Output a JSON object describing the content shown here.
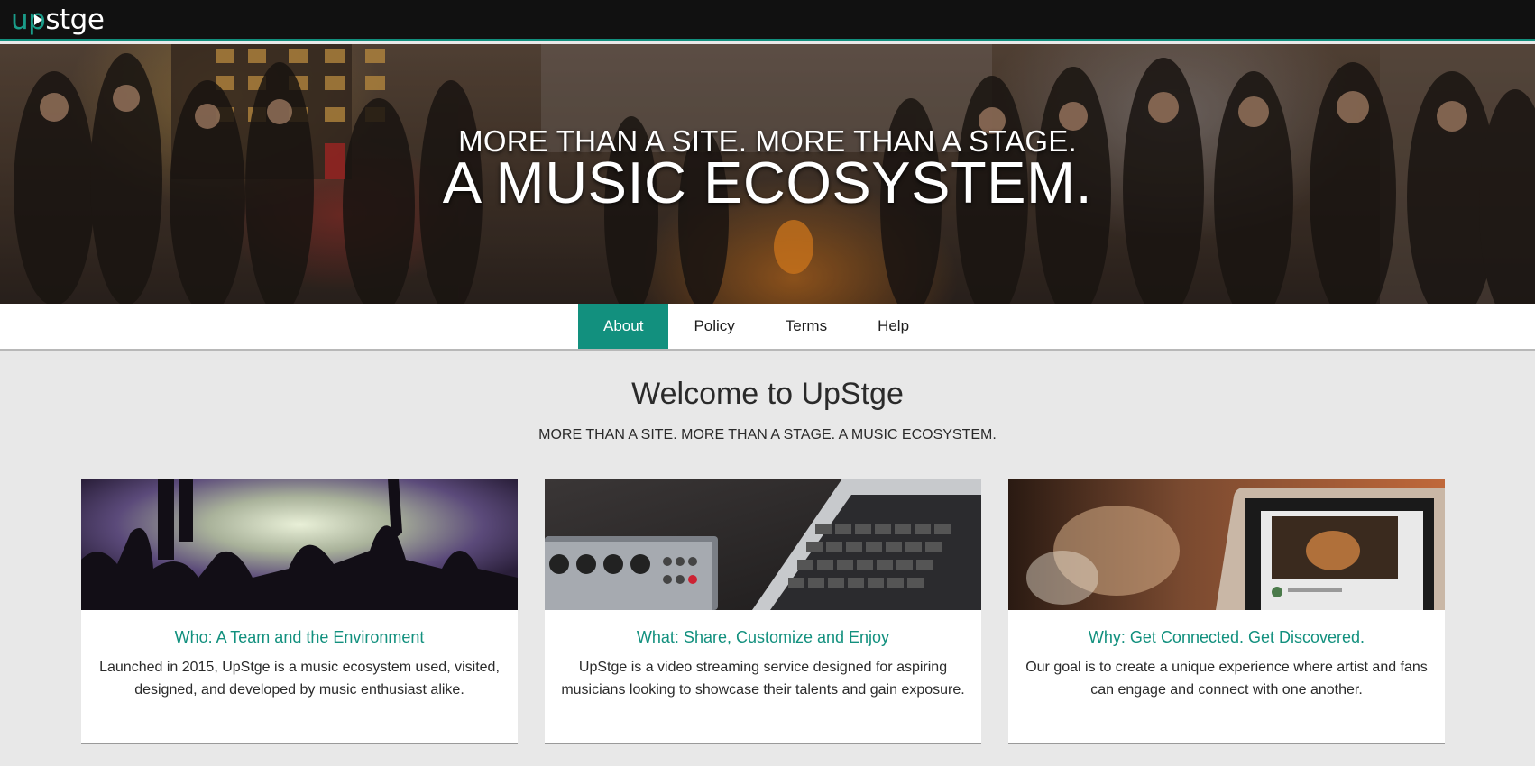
{
  "header": {
    "logo_text": "upstge",
    "logo_name": "UpStge"
  },
  "hero": {
    "tagline_line1": "MORE THAN A SITE. MORE THAN A STAGE.",
    "tagline_line2": "A MUSIC ECOSYSTEM."
  },
  "tabs": [
    {
      "label": "About",
      "active": true
    },
    {
      "label": "Policy",
      "active": false
    },
    {
      "label": "Terms",
      "active": false
    },
    {
      "label": "Help",
      "active": false
    }
  ],
  "welcome": {
    "title": "Welcome to UpStge",
    "subtitle": "MORE THAN A SITE. MORE THAN A STAGE. A MUSIC ECOSYSTEM."
  },
  "cards": [
    {
      "title": "Who: A Team and the Environment",
      "text": "Launched in 2015, UpStge is a music ecosystem used, visited, designed, and developed by music enthusiast alike.",
      "image": "concert-crowd-photo"
    },
    {
      "title": "What: Share, Customize and Enjoy",
      "text": "UpStge is a video streaming service designed for aspiring musicians looking to showcase their talents and gain exposure.",
      "image": "mixer-and-laptop-photo"
    },
    {
      "title": "Why: Get Connected. Get Discovered.",
      "text": "Our goal is to create a unique experience where artist and fans can engage and connect with one another.",
      "image": "guitarist-on-laptop-photo"
    }
  ],
  "colors": {
    "accent": "#12907e",
    "topbar": "#111111",
    "page_bg": "#e8e8e8"
  }
}
